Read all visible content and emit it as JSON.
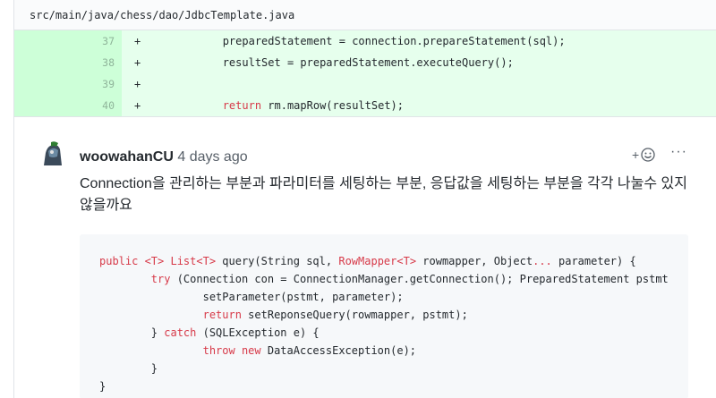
{
  "file": {
    "path": "src/main/java/chess/dao/JdbcTemplate.java"
  },
  "diff_lines": [
    {
      "number": "37",
      "marker": "+",
      "code": "            preparedStatement = connection.prepareStatement(sql);"
    },
    {
      "number": "38",
      "marker": "+",
      "code": "            resultSet = preparedStatement.executeQuery();"
    },
    {
      "number": "39",
      "marker": "+",
      "code": ""
    },
    {
      "number": "40",
      "marker": "+",
      "code_keyword": "return",
      "code_rest": " rm.mapRow(resultSet);"
    }
  ],
  "comment": {
    "author": "woowahanCU",
    "time": "4 days ago",
    "reaction_plus": "+",
    "more": "···",
    "body": "Connection을 관리하는 부분과 파라미터를 세팅하는 부분, 응답값을 세팅하는 부분을 각각 나눌수 있지 않을까요"
  },
  "code_snippet": {
    "lines": [
      [
        {
          "t": "public ",
          "c": "kw"
        },
        {
          "t": "<T> List<T>",
          "c": "kw"
        },
        {
          "t": " query(String sql, ",
          "c": ""
        },
        {
          "t": "RowMapper<T>",
          "c": "kw"
        },
        {
          "t": " rowmapper, Object",
          "c": ""
        },
        {
          "t": "...",
          "c": "kw"
        },
        {
          "t": " parameter) {",
          "c": ""
        }
      ],
      [
        {
          "t": "        ",
          "c": ""
        },
        {
          "t": "try",
          "c": "kw"
        },
        {
          "t": " (Connection con = ConnectionManager.getConnection(); PreparedStatement pstmt",
          "c": ""
        }
      ],
      [
        {
          "t": "                setParameter(pstmt, parameter);",
          "c": ""
        }
      ],
      [
        {
          "t": "                ",
          "c": ""
        },
        {
          "t": "return",
          "c": "kw"
        },
        {
          "t": " setReponseQuery(rowmapper, pstmt);",
          "c": ""
        }
      ],
      [
        {
          "t": "        } ",
          "c": ""
        },
        {
          "t": "catch",
          "c": "kw"
        },
        {
          "t": " (SQLException e) {",
          "c": ""
        }
      ],
      [
        {
          "t": "                ",
          "c": ""
        },
        {
          "t": "throw new",
          "c": "kw"
        },
        {
          "t": " DataAccessException(e);",
          "c": ""
        }
      ],
      [
        {
          "t": "        }",
          "c": ""
        }
      ],
      [
        {
          "t": "}",
          "c": ""
        }
      ]
    ]
  },
  "icons": {
    "avatar": "avatar-image",
    "reaction": "smiley-icon",
    "more": "kebab-icon"
  },
  "colors": {
    "diff_added_bg": "#e6ffed",
    "diff_added_num_bg": "#cdffd8",
    "keyword": "#d73a49",
    "code_block_bg": "#f6f8fa"
  }
}
